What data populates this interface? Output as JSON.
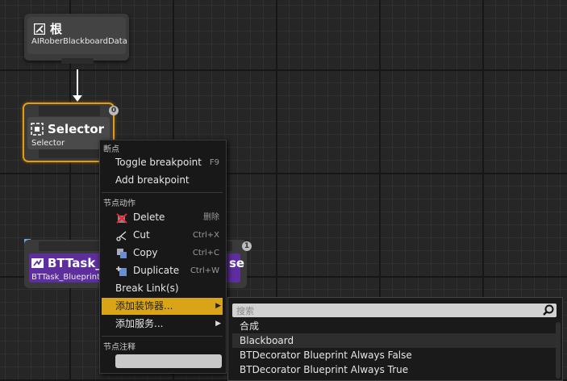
{
  "root_node": {
    "title": "根",
    "subtitle": "AIRoberBlackboardData"
  },
  "selector_node": {
    "title": "Selector",
    "subtitle": "Selector",
    "badge": "0"
  },
  "task_node": {
    "title": "BTTask_",
    "subtitle": "BTTask_Blueprint",
    "right_title": "se",
    "badge": "1"
  },
  "context_menu": {
    "section_breakpoint": "断点",
    "toggle_breakpoint": {
      "label": "Toggle breakpoint",
      "shortcut": "F9"
    },
    "add_breakpoint": {
      "label": "Add breakpoint"
    },
    "section_node_actions": "节点动作",
    "delete": {
      "label": "Delete",
      "shortcut": "删除"
    },
    "cut": {
      "label": "Cut",
      "shortcut": "Ctrl+X"
    },
    "copy": {
      "label": "Copy",
      "shortcut": "Ctrl+C"
    },
    "duplicate": {
      "label": "Duplicate",
      "shortcut": "Ctrl+W"
    },
    "break_links": {
      "label": "Break Link(s)"
    },
    "add_decorator": {
      "label": "添加装饰器..."
    },
    "add_service": {
      "label": "添加服务..."
    },
    "section_node_comment": "节点注释"
  },
  "submenu": {
    "search_placeholder": "搜索",
    "items": [
      "合成",
      "Blackboard",
      "BTDecorator Blueprint Always False",
      "BTDecorator Blueprint Always True"
    ]
  },
  "colors": {
    "selected_border": "#e59a13",
    "highlight": "#d9a418",
    "task_purple": "#5e2e9e"
  }
}
